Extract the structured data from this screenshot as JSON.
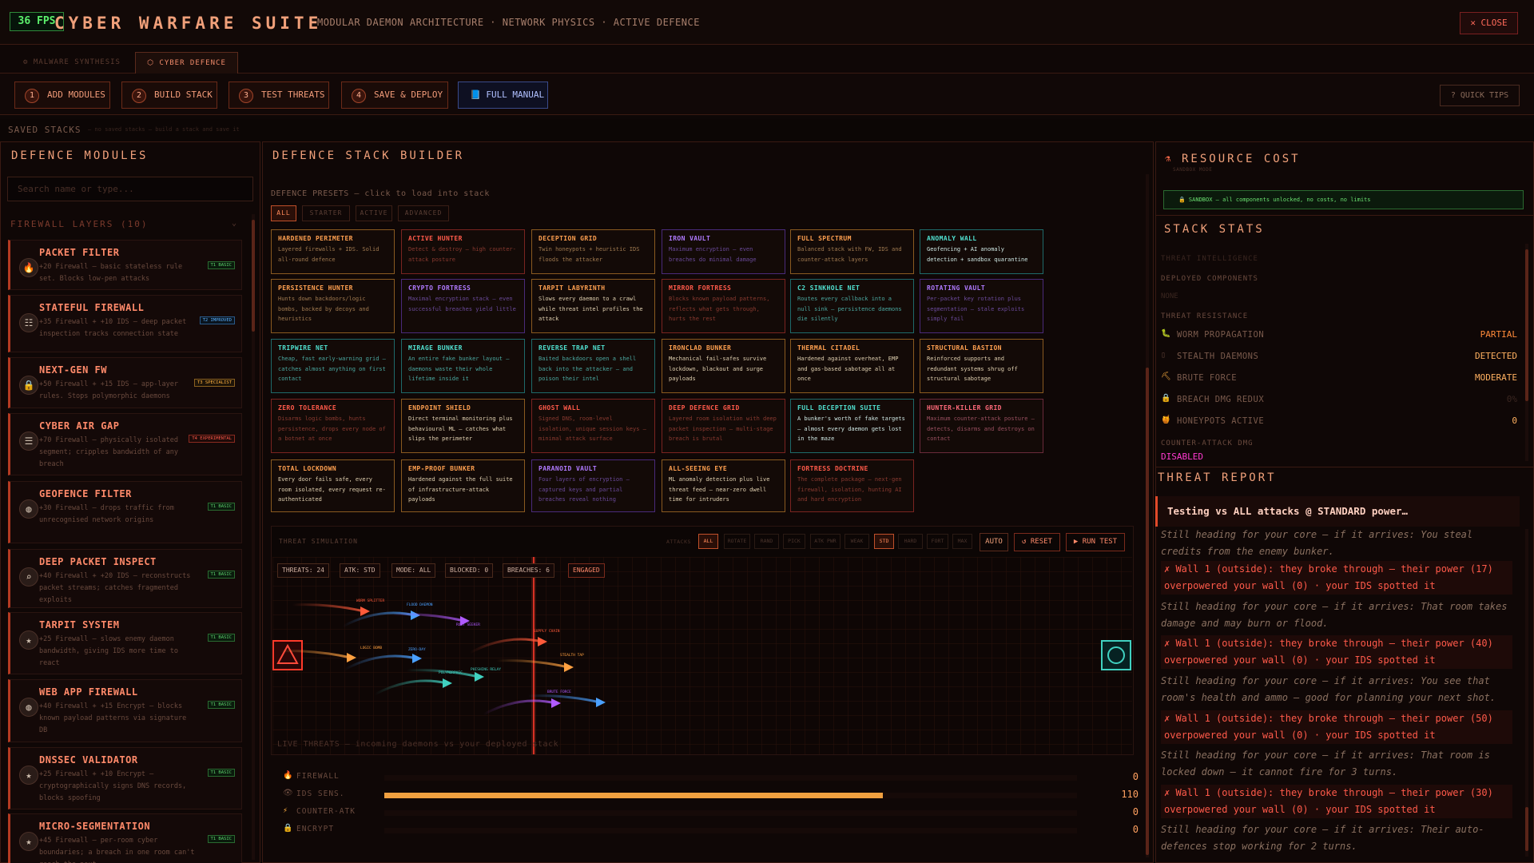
{
  "header": {
    "fps": "36 FPS",
    "title": "CYBER WARFARE SUITE",
    "subtitle": "MODULAR DAEMON ARCHITECTURE · NETWORK PHYSICS · ACTIVE DEFENCE",
    "close": "✕ CLOSE"
  },
  "tabs": {
    "malware": "⚙ MALWARE SYNTHESIS",
    "cyber": "⬡ CYBER DEFENCE"
  },
  "steps": [
    {
      "num": "1",
      "label": "ADD MODULES"
    },
    {
      "num": "2",
      "label": "BUILD STACK"
    },
    {
      "num": "3",
      "label": "TEST THREATS"
    },
    {
      "num": "4",
      "label": "SAVE & DEPLOY"
    }
  ],
  "full_manual": "📘 FULL MANUAL",
  "quick_tips": "? QUICK TIPS",
  "saved": {
    "label": "SAVED STACKS",
    "hint": "— no saved stacks — build a stack and save it"
  },
  "left": {
    "title": "DEFENCE MODULES",
    "search_placeholder": "Search name or type...",
    "group": "FIREWALL LAYERS (10)",
    "modules": [
      {
        "name": "PACKET FILTER",
        "desc": "+20 Firewall — basic stateless rule set. Blocks low-pen attacks",
        "badge": "T1 BASIC",
        "icon": "flame-icon",
        "glyph": "🔥"
      },
      {
        "name": "STATEFUL FIREWALL",
        "desc": "+35 Firewall + +10 IDS — deep packet inspection tracks connection state",
        "badge": "T2 IMPROVED",
        "icon": "firewall-icon",
        "glyph": "☷"
      },
      {
        "name": "NEXT-GEN FW",
        "desc": "+50 Firewall + +15 IDS — app-layer rules. Stops polymorphic daemons",
        "badge": "T3 SPECIALIST",
        "icon": "lock-icon",
        "glyph": "🔒"
      },
      {
        "name": "CYBER AIR GAP",
        "desc": "+70 Firewall — physically isolated segment; cripples bandwidth of any breach",
        "badge": "T4 EXPERIMENTAL",
        "icon": "airgap-icon",
        "glyph": "☰"
      },
      {
        "name": "GEOFENCE FILTER",
        "desc": "+30 Firewall — drops traffic from unrecognised network origins",
        "badge": "T1 BASIC",
        "icon": "globe-icon",
        "glyph": "◍"
      },
      {
        "name": "DEEP PACKET INSPECT",
        "desc": "+40 Firewall + +20 IDS — reconstructs packet streams; catches fragmented exploits",
        "badge": "T1 BASIC",
        "icon": "magnifier-icon",
        "glyph": "⌕"
      },
      {
        "name": "TARPIT SYSTEM",
        "desc": "+25 Firewall — slows enemy daemon bandwidth, giving IDS more time to react",
        "badge": "T1 BASIC",
        "icon": "star-icon",
        "glyph": "★"
      },
      {
        "name": "WEB APP FIREWALL",
        "desc": "+40 Firewall + +15 Encrypt — blocks known payload patterns via signature DB",
        "badge": "T1 BASIC",
        "icon": "globe-icon",
        "glyph": "◍"
      },
      {
        "name": "DNSSEC VALIDATOR",
        "desc": "+25 Firewall + +10 Encrypt — cryptographically signs DNS records, blocks spoofing",
        "badge": "T1 BASIC",
        "icon": "star-icon",
        "glyph": "★"
      },
      {
        "name": "MICRO-SEGMENTATION",
        "desc": "+45 Firewall — per-room cyber boundaries; a breach in one room can't reach the next",
        "badge": "T1 BASIC",
        "icon": "star-icon",
        "glyph": "★"
      }
    ]
  },
  "mid": {
    "title": "DEFENCE STACK BUILDER",
    "presets_label": "DEFENCE PRESETS — click to load into stack",
    "filters": [
      "ALL",
      "STARTER",
      "ACTIVE",
      "ADVANCED"
    ],
    "presets": [
      {
        "name": "HARDENED PERIMETER",
        "desc": "Layered firewalls + IDS. Solid all-round defence",
        "style": "c-orange"
      },
      {
        "name": "ACTIVE HUNTER",
        "desc": "Detect & destroy — high counter-attack posture",
        "style": "c-red"
      },
      {
        "name": "DECEPTION GRID",
        "desc": "Twin honeypots + heuristic IDS floods the attacker",
        "style": "c-orange"
      },
      {
        "name": "IRON VAULT",
        "desc": "Maximum encryption — even breaches do minimal damage",
        "style": "c-purple"
      },
      {
        "name": "FULL SPECTRUM",
        "desc": "Balanced stack with FW, IDS and counter-attack layers",
        "style": "c-orange"
      },
      {
        "name": "ANOMALY WALL",
        "desc": "Geofencing + AI anomaly detection + sandbox quarantine",
        "style": "c-cyanb"
      },
      {
        "name": "PERSISTENCE HUNTER",
        "desc": "Hunts down backdoors/logic bombs, backed by decoys and heuristics",
        "style": "c-orange"
      },
      {
        "name": "CRYPTO FORTRESS",
        "desc": "Maximal encryption stack — even successful breaches yield little",
        "style": "c-purple"
      },
      {
        "name": "TARPIT LABYRINTH",
        "desc": "Slows every daemon to a crawl while threat intel profiles the attack",
        "style": "c-orangeb"
      },
      {
        "name": "MIRROR FORTRESS",
        "desc": "Blocks known payload patterns, reflects what gets through, hurts the rest",
        "style": "c-red"
      },
      {
        "name": "C2 SINKHOLE NET",
        "desc": "Routes every callback into a null sink — persistence daemons die silently",
        "style": "c-cyan"
      },
      {
        "name": "ROTATING VAULT",
        "desc": "Per-packet key rotation plus segmentation — stale exploits simply fail",
        "style": "c-purple"
      },
      {
        "name": "TRIPWIRE NET",
        "desc": "Cheap, fast early-warning grid — catches almost anything on first contact",
        "style": "c-cyan"
      },
      {
        "name": "MIRAGE BUNKER",
        "desc": "An entire fake bunker layout — daemons waste their whole lifetime inside it",
        "style": "c-cyan"
      },
      {
        "name": "REVERSE TRAP NET",
        "desc": "Baited backdoors open a shell back into the attacker — and poison their intel",
        "style": "c-cyan"
      },
      {
        "name": "IRONCLAD BUNKER",
        "desc": "Mechanical fail-safes survive lockdown, blackout and surge payloads",
        "style": "c-orangeb"
      },
      {
        "name": "THERMAL CITADEL",
        "desc": "Hardened against overheat, EMP and gas-based sabotage all at once",
        "style": "c-orangeb"
      },
      {
        "name": "STRUCTURAL BASTION",
        "desc": "Reinforced supports and redundant systems shrug off structural sabotage",
        "style": "c-orangeb"
      },
      {
        "name": "ZERO TOLERANCE",
        "desc": "Disarms logic bombs, hunts persistence, drops every node of a botnet at once",
        "style": "c-red"
      },
      {
        "name": "ENDPOINT SHIELD",
        "desc": "Direct terminal monitoring plus behavioural ML — catches what slips the perimeter",
        "style": "c-orangeb"
      },
      {
        "name": "GHOST WALL",
        "desc": "Signed DNS, room-level isolation, unique session keys — minimal attack surface",
        "style": "c-red"
      },
      {
        "name": "DEEP DEFENCE GRID",
        "desc": "Layered room isolation with deep packet inspection — multi-stage breach is brutal",
        "style": "c-red"
      },
      {
        "name": "FULL DECEPTION SUITE",
        "desc": "A bunker's worth of fake targets — almost every daemon gets lost in the maze",
        "style": "c-cyanb"
      },
      {
        "name": "HUNTER-KILLER GRID",
        "desc": "Maximum counter-attack posture — detects, disarms and destroys on contact",
        "style": "c-pink"
      },
      {
        "name": "TOTAL LOCKDOWN",
        "desc": "Every door fails safe, every room isolated, every request re-authenticated",
        "style": "c-orangeb"
      },
      {
        "name": "EMP-PROOF BUNKER",
        "desc": "Hardened against the full suite of infrastructure-attack payloads",
        "style": "c-orangeb"
      },
      {
        "name": "PARANOID VAULT",
        "desc": "Four layers of encryption — captured keys and partial breaches reveal nothing",
        "style": "c-purple"
      },
      {
        "name": "ALL-SEEING EYE",
        "desc": "ML anomaly detection plus live threat feed — near-zero dwell time for intruders",
        "style": "c-orangeb"
      },
      {
        "name": "FORTRESS DOCTRINE",
        "desc": "The complete package — next-gen firewall, isolation, hunting AI and hard encryption",
        "style": "c-red"
      }
    ],
    "sim": {
      "label": "THREAT SIMULATION",
      "attacks_label": "ATTACKS",
      "attack_filters": [
        "ALL",
        "ROTATE",
        "RAND",
        "PICK",
        "ATK PWR",
        "WEAK",
        "STD",
        "HARD",
        "FORT",
        "MAX"
      ],
      "auto": "AUTO",
      "reset": "↺ RESET",
      "run": "▶ RUN TEST",
      "chips": [
        "THREATS: 24",
        "ATK: STD",
        "MODE: ALL",
        "BLOCKED: 0",
        "BREACHES: 6",
        "ENGAGED"
      ],
      "live_label": "LIVE THREATS — incoming daemons vs your deployed stack",
      "threat_labels": [
        "WORM SPLITTER",
        "FLOOD DAEMON",
        "ROOT SEEKER",
        "SUPPLY CHAIN",
        "LOGIC BOMB",
        "ZERO-DAY",
        "PHISHING RELAY",
        "POLYMORPHIC",
        "STEALTH TAP",
        "BRUTE FORCE"
      ]
    },
    "stats": [
      {
        "label": "FIREWALL",
        "value": "0",
        "fill": 0,
        "icon": "flame-icon",
        "glyph": "🔥"
      },
      {
        "label": "IDS SENS.",
        "value": "110",
        "fill": 0.72,
        "icon": "eye-icon",
        "glyph": "👁"
      },
      {
        "label": "COUNTER-ATK",
        "value": "0",
        "fill": 0,
        "icon": "bolt-icon",
        "glyph": "⚡"
      },
      {
        "label": "ENCRYPT",
        "value": "0",
        "fill": 0,
        "icon": "lock-icon",
        "glyph": "🔒"
      }
    ]
  },
  "right": {
    "resource_title": "RESOURCE COST",
    "sandbox_mode": "SANDBOX MODE",
    "sandbox_banner": "🔒 SANDBOX — all components unlocked, no costs, no limits",
    "stats_title": "STACK STATS",
    "threat_intel": "THREAT INTELLIGENCE",
    "deployed": "DEPLOYED COMPONENTS",
    "none": "NONE",
    "threat_resistance": "THREAT RESISTANCE",
    "resistance": [
      {
        "glyph": "🐛",
        "name": "WORM PROPAGATION",
        "value": "PARTIAL",
        "color": "#ff8a3a"
      },
      {
        "glyph": "▯",
        "name": "STEALTH DAEMONS",
        "value": "DETECTED",
        "color": "#ffb060"
      },
      {
        "glyph": "⛏",
        "name": "BRUTE FORCE",
        "value": "MODERATE",
        "color": "#ffb060"
      },
      {
        "glyph": "🔒",
        "name": "BREACH DMG REDUX",
        "value": "0%",
        "color": "#3a2620"
      },
      {
        "glyph": "🍯",
        "name": "HONEYPOTS ACTIVE",
        "value": "0",
        "color": "#ffb060"
      }
    ],
    "counter_label": "COUNTER-ATTACK DMG",
    "counter_value": "DISABLED",
    "report_title": "THREAT REPORT",
    "report_head": "Testing vs ALL attacks @ STANDARD power…",
    "log": [
      {
        "type": "info",
        "text": "Still heading for your core — if it arrives: You steal credits from the enemy bunker."
      },
      {
        "type": "bad",
        "text": "✗ Wall 1 (outside): they broke through — their power (17) overpowered your wall (0) · your IDS spotted it"
      },
      {
        "type": "info",
        "text": "Still heading for your core — if it arrives: That room takes damage and may burn or flood."
      },
      {
        "type": "bad",
        "text": "✗ Wall 1 (outside): they broke through — their power (40) overpowered your wall (0) · your IDS spotted it"
      },
      {
        "type": "info",
        "text": "Still heading for your core — if it arrives: You see that room's health and ammo — good for planning your next shot."
      },
      {
        "type": "bad",
        "text": "✗ Wall 1 (outside): they broke through — their power (50) overpowered your wall (0) · your IDS spotted it"
      },
      {
        "type": "info",
        "text": "Still heading for your core — if it arrives: That room is locked down — it cannot fire for 3 turns."
      },
      {
        "type": "bad",
        "text": "✗ Wall 1 (outside): they broke through — their power (30) overpowered your wall (0) · your IDS spotted it"
      },
      {
        "type": "info",
        "text": "Still heading for your core — if it arrives: Their auto-defences stop working for 2 turns."
      }
    ]
  }
}
